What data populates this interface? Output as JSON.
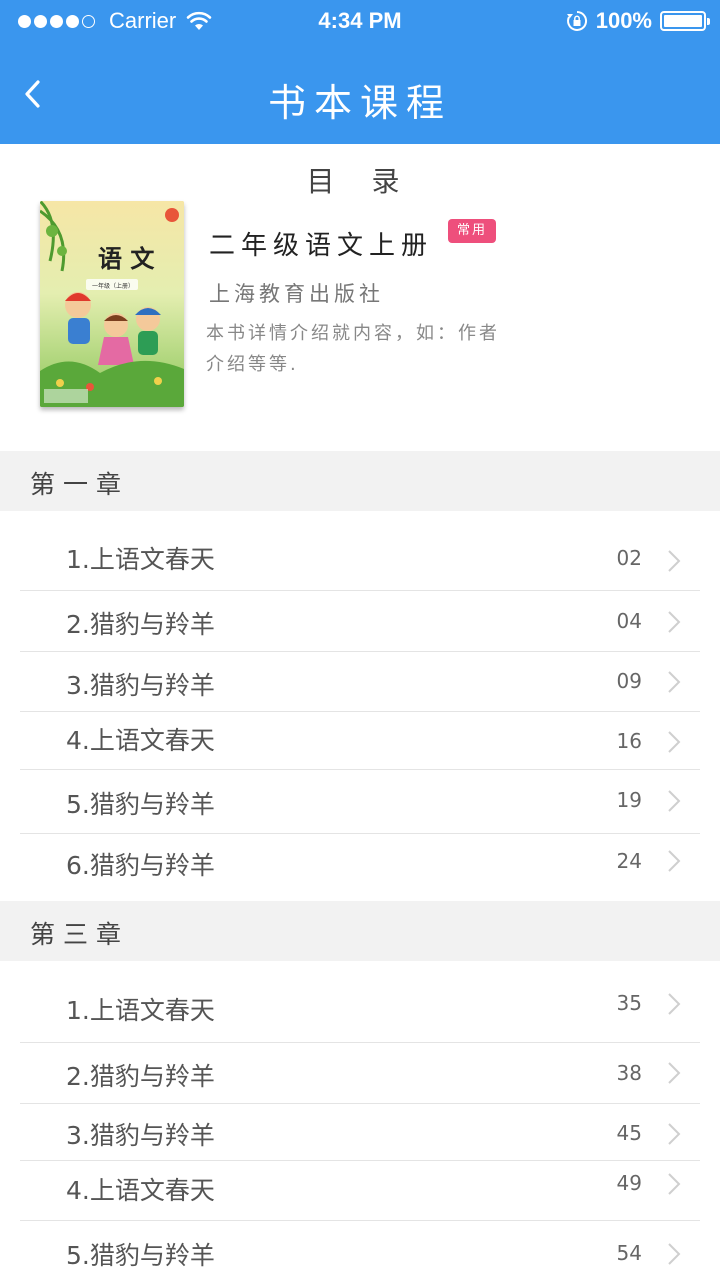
{
  "status_bar": {
    "carrier": "Carrier",
    "time": "4:34 PM",
    "battery": "100%"
  },
  "nav": {
    "title": "书本课程"
  },
  "toc_title": "目 录",
  "book": {
    "title": "二年级语文上册",
    "badge": "常用",
    "publisher": "上海教育出版社",
    "description": "本书详情介绍就内容，如：作者介绍等等.",
    "cover": {
      "title": "语 文",
      "sub": "一年级（上册）"
    }
  },
  "chapters": [
    {
      "label": "第一章",
      "lessons": [
        {
          "title": "1.上语文春天",
          "page": "02"
        },
        {
          "title": "2.猎豹与羚羊",
          "page": "04"
        },
        {
          "title": "3.猎豹与羚羊",
          "page": "09"
        },
        {
          "title": "4.上语文春天",
          "page": "16"
        },
        {
          "title": "5.猎豹与羚羊",
          "page": "19"
        },
        {
          "title": "6.猎豹与羚羊",
          "page": "24"
        }
      ]
    },
    {
      "label": "第三章",
      "lessons": [
        {
          "title": "1.上语文春天",
          "page": "35"
        },
        {
          "title": "2.猎豹与羚羊",
          "page": "38"
        },
        {
          "title": "3.猎豹与羚羊",
          "page": "45"
        },
        {
          "title": "4.上语文春天",
          "page": "49"
        },
        {
          "title": "5.猎豹与羚羊",
          "page": "54"
        }
      ]
    }
  ],
  "colors": {
    "primary": "#3a96ee",
    "badge": "#ee4f7c",
    "section_bg": "#f2f2f2"
  }
}
